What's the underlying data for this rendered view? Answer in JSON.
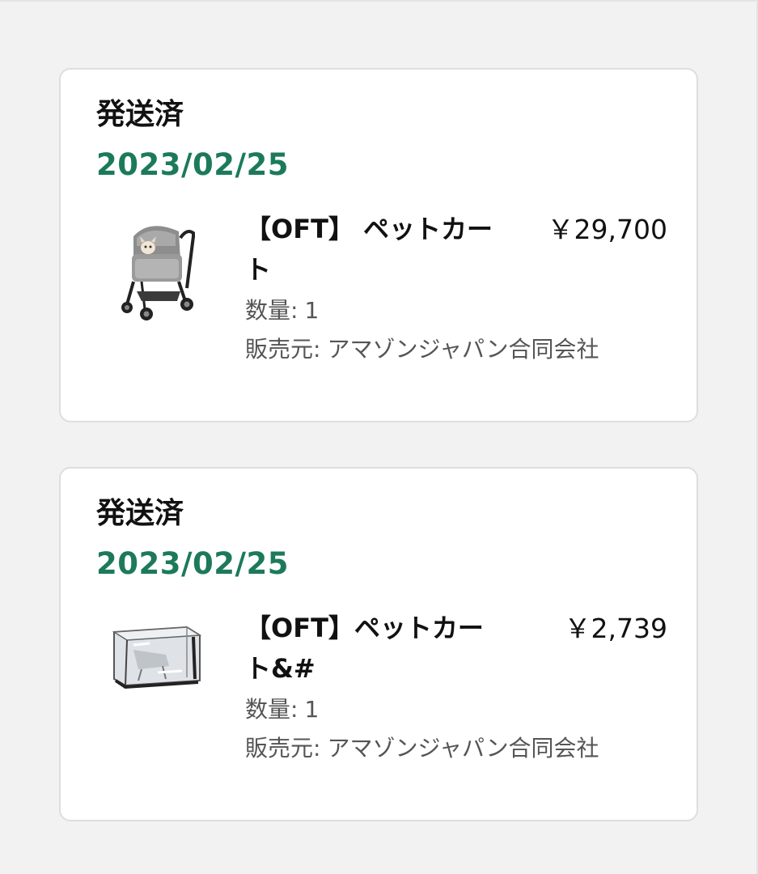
{
  "orders": [
    {
      "status": "発送済",
      "date": "2023/02/25",
      "product_title": "【OFT】 ペットカート",
      "price": "￥29,700",
      "quantity_label": "数量:",
      "quantity_value": "1",
      "seller_label": "販売元:",
      "seller_value": "アマゾンジャパン合同会社",
      "thumbnail_icon": "pet-stroller-image"
    },
    {
      "status": "発送済",
      "date": "2023/02/25",
      "product_title": "【OFT】ペットカート&#",
      "price": "￥2,739",
      "quantity_label": "数量:",
      "quantity_value": "1",
      "seller_label": "販売元:",
      "seller_value": "アマゾンジャパン合同会社",
      "thumbnail_icon": "rain-cover-image"
    }
  ],
  "colors": {
    "date_green": "#1c7a5a",
    "text_dark": "#111111",
    "text_gray": "#555555",
    "card_border": "#dedede",
    "page_bg": "#f2f2f2"
  }
}
